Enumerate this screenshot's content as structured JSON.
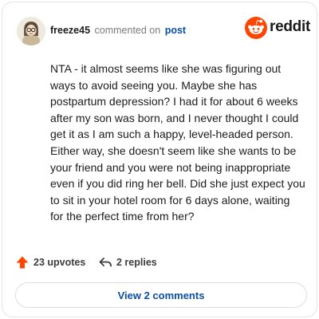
{
  "header": {
    "username": "freeze45",
    "action_text": "commented on",
    "post_link": "post",
    "brand_name": "reddit",
    "avatar_icon": "avatar-icon",
    "logo_icon": "reddit-logo-icon"
  },
  "comment": {
    "body": "NTA - it almost seems like she was figuring out ways to avoid seeing you. Maybe she has postpartum depression? I had it for about 6 weeks after my son was born, and I never thought I could get it as I am such a happy, level-headed person. Either way, she doesn't seem like she wants to be your friend and you were not being inappropriate even if you did ring her bell. Did she just expect you to sit in your hotel room for 6 days alone, waiting for the perfect time from her?"
  },
  "stats": {
    "upvotes_label": "23 upvotes",
    "replies_label": "2 replies",
    "upvote_icon": "upvote-arrow-icon",
    "reply_icon": "reply-arrow-icon"
  },
  "footer": {
    "view_comments_label": "View 2 comments"
  },
  "colors": {
    "brand_orange": "#ff4500",
    "link_blue": "#0a4fa6",
    "text_dark": "#1c1c1c",
    "muted": "#7c7c7c"
  }
}
